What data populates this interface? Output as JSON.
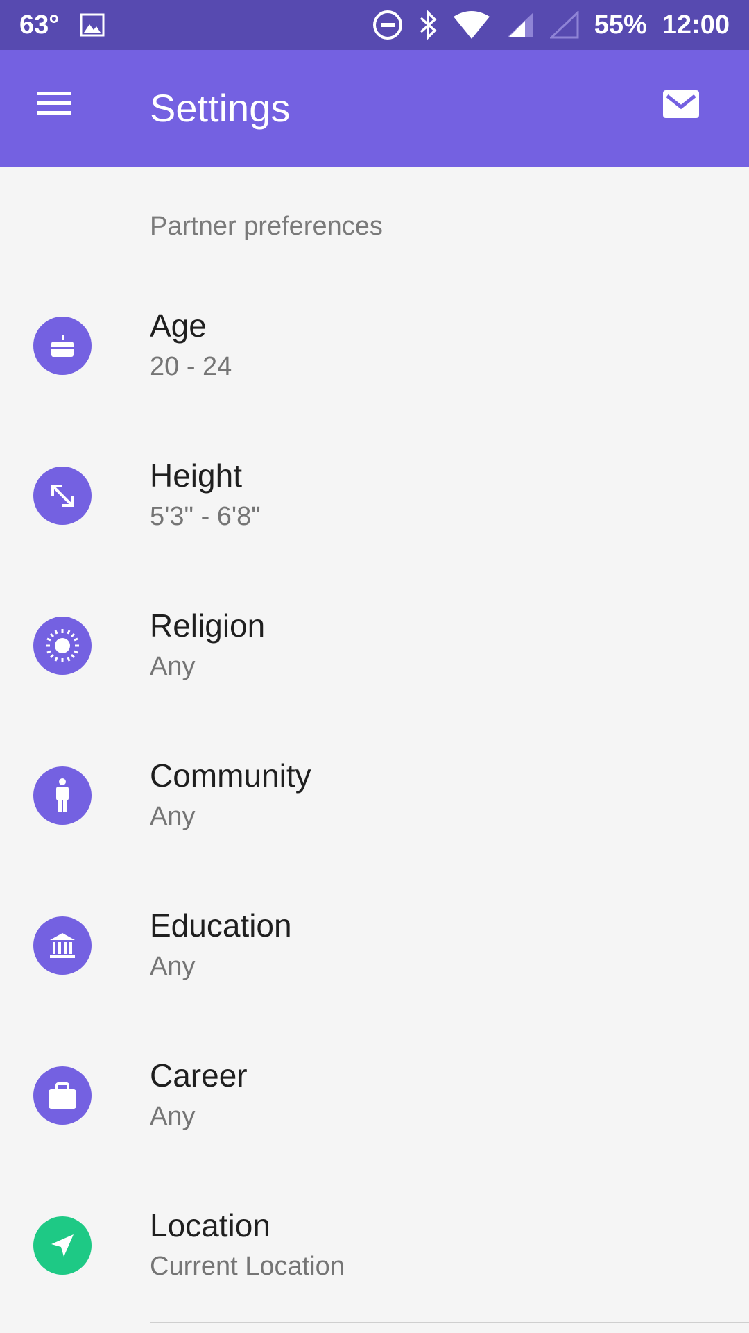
{
  "status_bar": {
    "temperature": "63°",
    "battery": "55%",
    "time": "12:00"
  },
  "app_bar": {
    "title": "Settings",
    "menu_icon": "hamburger-menu-icon",
    "action_icon": "mail-icon"
  },
  "section": {
    "header": "Partner preferences"
  },
  "colors": {
    "status_bar": "#574ab0",
    "app_bar": "#7461e1",
    "icon_purple": "#7461e1",
    "icon_green": "#1ec985",
    "background": "#f5f5f5"
  },
  "preferences": [
    {
      "label": "Age",
      "value": "20 - 24",
      "icon": "cake-icon"
    },
    {
      "label": "Height",
      "value": "5'3\" - 6'8\"",
      "icon": "resize-arrow-icon"
    },
    {
      "label": "Religion",
      "value": "Any",
      "icon": "sun-icon"
    },
    {
      "label": "Community",
      "value": "Any",
      "icon": "person-icon"
    },
    {
      "label": "Education",
      "value": "Any",
      "icon": "institution-icon"
    },
    {
      "label": "Career",
      "value": "Any",
      "icon": "briefcase-icon"
    },
    {
      "label": "Location",
      "value": "Current Location",
      "icon": "navigation-icon"
    }
  ]
}
